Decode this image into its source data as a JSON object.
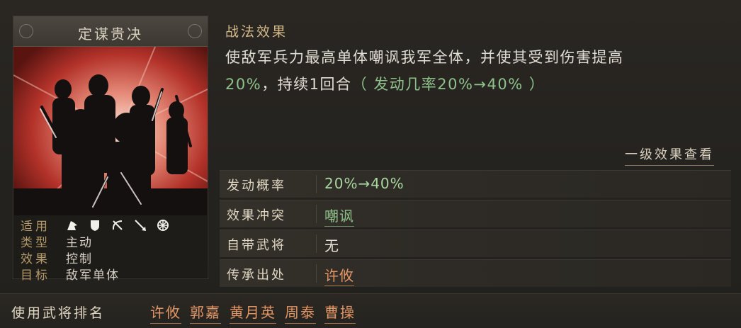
{
  "card": {
    "title": "定谋贵决",
    "props": [
      {
        "label": "适用",
        "value": ""
      },
      {
        "label": "类型",
        "value": "主动"
      },
      {
        "label": "效果",
        "value": "控制"
      },
      {
        "label": "目标",
        "value": "敌军单体"
      }
    ],
    "unit_icons": [
      "cavalry-icon",
      "shield-icon",
      "bow-icon",
      "spear-icon",
      "chariot-icon"
    ]
  },
  "effect": {
    "heading": "战法效果",
    "line1": "使敌军兵力最高单体嘲讽我军全体，并使其受到伤害提高",
    "line2_pct": "20%",
    "line2_mid": "，持续1回合",
    "line2_paren": "（ 发动几率20%→40% ）",
    "view_more": "一级效果查看"
  },
  "rows": [
    {
      "label": "发动概率",
      "value": "20%→40%"
    },
    {
      "label": "效果冲突",
      "value": "嘲讽"
    },
    {
      "label": "自带武将",
      "value": "无"
    },
    {
      "label": "传承出处",
      "value": "许攸"
    }
  ],
  "bottom": {
    "label": "使用武将排名",
    "names": [
      "许攸",
      "郭嘉",
      "黄月英",
      "周泰",
      "曹操"
    ]
  },
  "colors": {
    "accent_gold": "#d3b88a",
    "green": "#8fc28b",
    "orange_link": "#e29564"
  }
}
